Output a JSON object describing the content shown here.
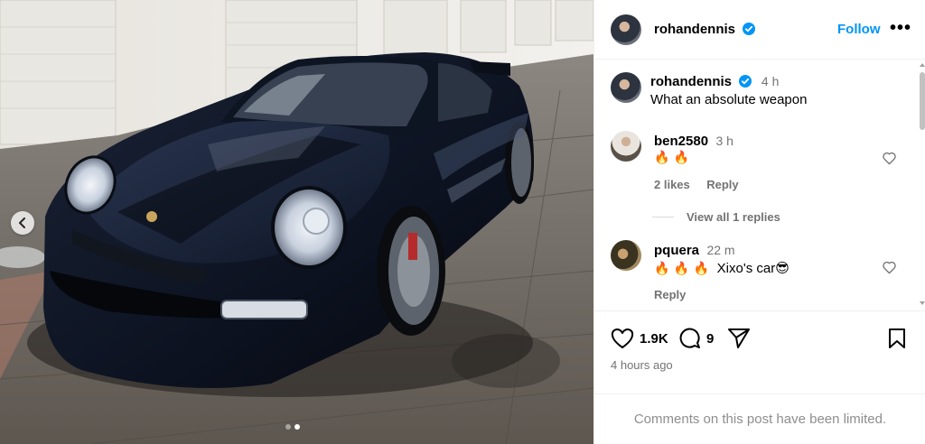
{
  "post": {
    "author": "rohandennis",
    "follow_label": "Follow",
    "more_label": "•••",
    "caption": {
      "username": "rohandennis",
      "time": "4 h",
      "text": "What an absolute weapon"
    },
    "comments": [
      {
        "username": "ben2580",
        "time": "3 h",
        "emojis": "🔥 🔥",
        "text": "",
        "likes": "2 likes",
        "reply_label": "Reply"
      },
      {
        "username": "pquera",
        "time": "22 m",
        "emojis": "🔥 🔥 🔥",
        "text": "Xixo's car😎",
        "reply_label": "Reply"
      }
    ],
    "view_replies_label": "View all 1 replies",
    "like_count": "1.9K",
    "comment_count": "9",
    "posted_time": "4 hours ago",
    "comments_limited_notice": "Comments on this post have been limited."
  },
  "carousel": {
    "total": 2,
    "active_index": 1
  },
  "icons": {
    "verified": "verified-badge-icon",
    "like": "heart-icon",
    "comment": "comment-bubble-icon",
    "share": "paper-plane-icon",
    "save": "bookmark-icon",
    "prev": "chevron-left-icon"
  },
  "colors": {
    "accent": "#0095f6",
    "verified": "#0095f6",
    "muted": "#737373"
  }
}
